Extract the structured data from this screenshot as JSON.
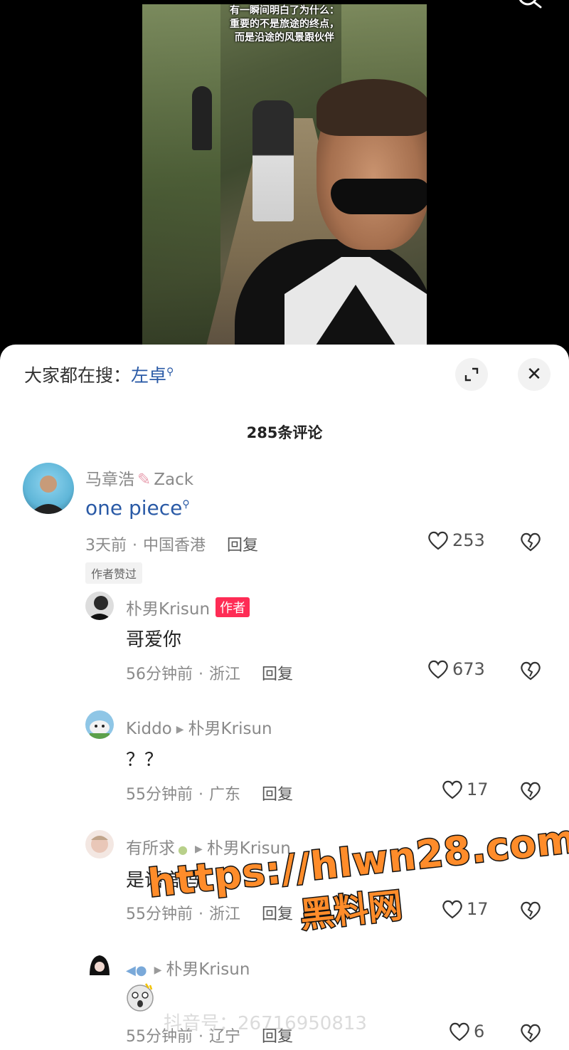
{
  "video": {
    "caption_lines": [
      "有一瞬间明白了为什么：",
      "重要的不是旅途的终点，",
      "而是沿途的风景跟伙伴"
    ],
    "search_icon": "search-icon"
  },
  "sheet": {
    "trend_prefix": "大家都在搜：",
    "trend_term": "左卓",
    "expand_icon": "expand-icon",
    "close_icon": "close-icon",
    "close_glyph": "✕",
    "comment_count": "285条评论"
  },
  "comments": [
    {
      "name": "马章浩",
      "name_suffix": "Zack",
      "text": "one piece",
      "time": "3天前",
      "location": "中国香港",
      "reply": "回复",
      "likes": "253",
      "tag": "作者赞过"
    },
    {
      "name": "朴男Krisun",
      "badge": "作者",
      "text": "哥爱你",
      "time": "56分钟前",
      "location": "浙江",
      "reply": "回复",
      "likes": "673"
    },
    {
      "name": "Kiddo",
      "reply_to": "朴男Krisun",
      "text": "？？",
      "time": "55分钟前",
      "location": "广东",
      "reply": "回复",
      "likes": "17"
    },
    {
      "name": "有所求",
      "reply_to": "朴男Krisun",
      "text": "是谣言吗",
      "time": "55分钟前",
      "location": "浙江",
      "reply": "回复",
      "likes": "17"
    },
    {
      "name": "",
      "reply_to": "朴男Krisun",
      "text": "",
      "time": "55分钟前",
      "location": "辽宁",
      "reply": "回复",
      "likes": "6"
    }
  ],
  "watermark": {
    "url": "https://hlwn28.com",
    "name": "黑料网",
    "douyin_id": "抖音号：26716950813"
  },
  "colors": {
    "accent_blue": "#2a5aa6",
    "author_badge": "#fe2c55",
    "watermark_orange": "#ff8c2a"
  }
}
